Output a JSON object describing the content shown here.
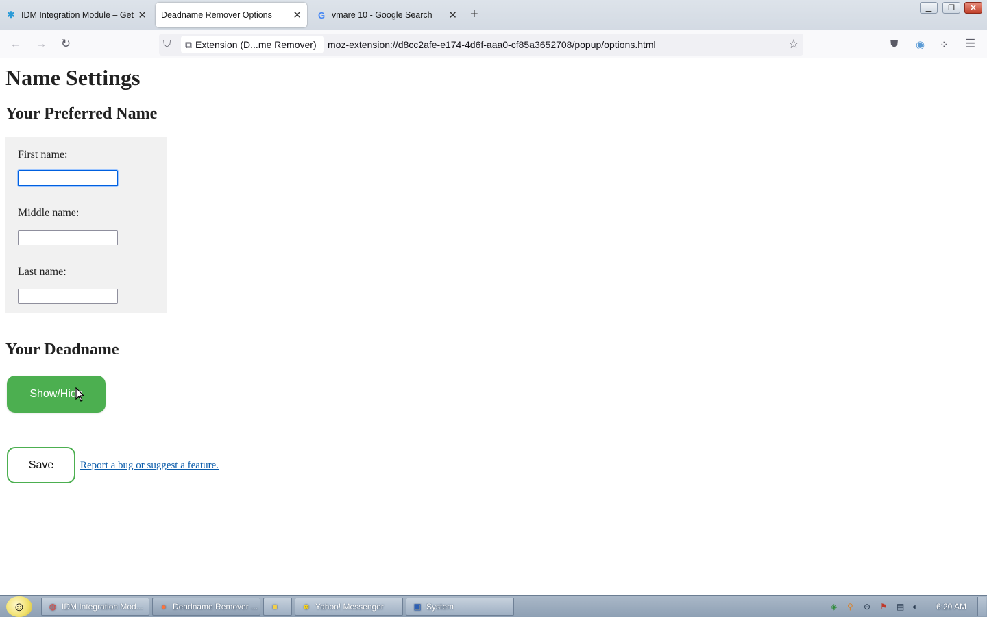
{
  "browser": {
    "tabs": [
      {
        "title": "IDM Integration Module – Get t",
        "icon": "idm-icon"
      },
      {
        "title": "Deadname Remover Options",
        "icon": "none"
      },
      {
        "title": "vmare 10 - Google Search",
        "icon": "google-icon"
      }
    ],
    "identity_label": "Extension (D...me Remover)",
    "url": "moz-extension://d8cc2afe-e174-4d6f-aaa0-cf85a3652708/popup/options.html"
  },
  "page": {
    "title": "Name Settings",
    "preferred_heading": "Your Preferred Name",
    "first_label": "First name:",
    "first_value": "",
    "middle_label": "Middle name:",
    "middle_value": "",
    "last_label": "Last name:",
    "last_value": "",
    "deadname_heading": "Your Deadname",
    "show_hide_label": "Show/Hide",
    "save_label": "Save",
    "report_link": "Report a bug or suggest a feature."
  },
  "taskbar": {
    "tasks": [
      {
        "label": "IDM Integration Mod...",
        "icon": "chrome-icon"
      },
      {
        "label": "Deadname Remover ...",
        "icon": "firefox-icon"
      },
      {
        "label": "",
        "icon": "folder-icon"
      },
      {
        "label": "Yahoo! Messenger",
        "icon": "yahoo-messenger-icon"
      },
      {
        "label": "System",
        "icon": "system-icon"
      }
    ],
    "clock": "6:20 AM"
  },
  "colors": {
    "accent_green": "#4caf50",
    "link_blue": "#0b5cab",
    "focus_blue": "#0060df"
  }
}
